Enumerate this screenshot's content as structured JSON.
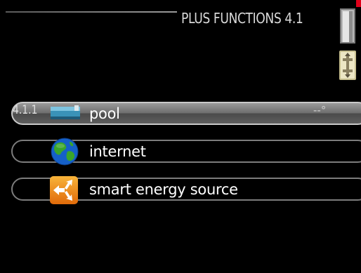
{
  "header": {
    "title": "PLUS FUNCTIONS 4.1"
  },
  "menu": {
    "items": [
      {
        "number": "4.1.1",
        "label": "pool",
        "value": "--°",
        "icon": "pool-icon",
        "selected": true
      },
      {
        "number": "",
        "label": "internet",
        "value": "",
        "icon": "globe-icon",
        "selected": false
      },
      {
        "number": "",
        "label": "smart energy source",
        "value": "",
        "icon": "smart-energy-icon",
        "selected": false
      }
    ]
  },
  "colors": {
    "background": "#000000",
    "row_border": "#7c7c7c",
    "selected_fill": "#7a7a7a",
    "marker": "#e0001a",
    "globe_ocean": "#1560c8",
    "globe_land": "#3aa52a",
    "energy_orange": "#f08a10"
  }
}
